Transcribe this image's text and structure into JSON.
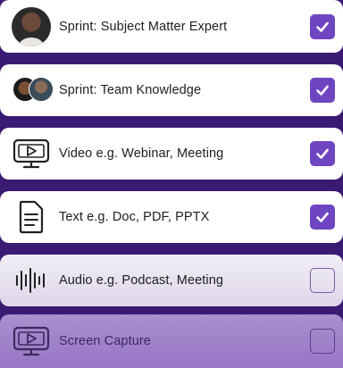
{
  "options": [
    {
      "label": "Sprint: Subject Matter Expert",
      "icon": "person-avatar-icon",
      "checked": true
    },
    {
      "label": "Sprint: Team Knowledge",
      "icon": "team-avatars-icon",
      "checked": true
    },
    {
      "label": "Video e.g. Webinar, Meeting",
      "icon": "video-monitor-icon",
      "checked": true
    },
    {
      "label": "Text e.g. Doc, PDF, PPTX",
      "icon": "document-icon",
      "checked": true
    },
    {
      "label": "Audio e.g. Podcast, Meeting",
      "icon": "audio-waveform-icon",
      "checked": false
    },
    {
      "label": "Screen Capture",
      "icon": "screen-capture-icon",
      "checked": false
    }
  ],
  "colors": {
    "background": "#3a1a72",
    "accent": "#6f45c2",
    "row": "#ffffff"
  }
}
